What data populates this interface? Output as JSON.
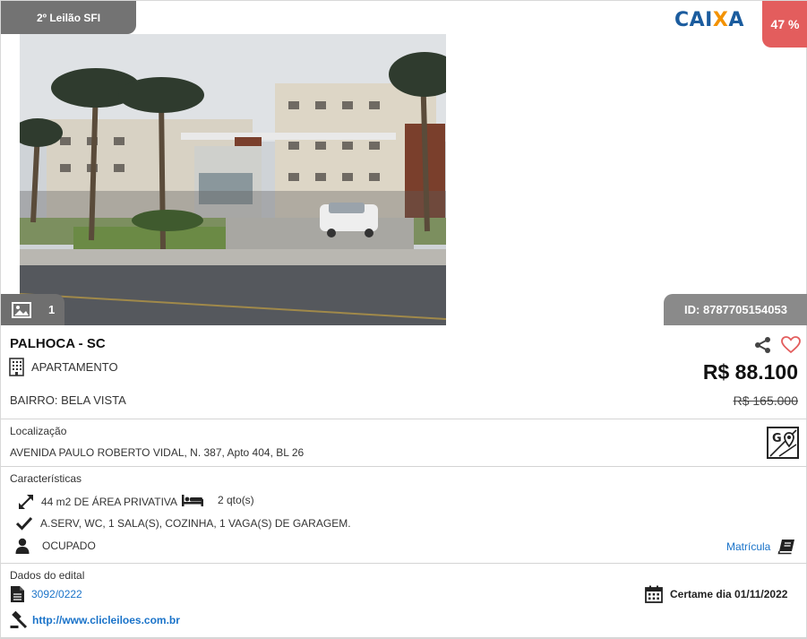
{
  "listing": {
    "auction_tag": "2º Leilão SFI",
    "bank": {
      "logo_text_left": "CAI",
      "logo_text_x": "X",
      "logo_text_right": "A",
      "color": "#1b5c9e",
      "accent": "#f39200"
    },
    "discount": "47 %",
    "photo_count": "1",
    "id_label": "ID: 8787705154053",
    "city": "PALHOCA - SC",
    "property_type": "APARTAMENTO",
    "neighborhood": "BAIRRO: BELA VISTA",
    "price": "R$ 88.100",
    "old_price": "R$ 165.000"
  },
  "location": {
    "title": "Localização",
    "address": "AVENIDA PAULO ROBERTO VIDAL, N. 387, Apto 404, BL 26"
  },
  "features": {
    "title": "Características",
    "area": "44 m2 DE ÁREA PRIVATIVA",
    "bedrooms": "2 qto(s)",
    "rooms": "A.SERV, WC, 1 SALA(S), COZINHA, 1 VAGA(S) DE GARAGEM.",
    "occupancy": "OCUPADO",
    "registry_link": "Matrícula"
  },
  "edital": {
    "title": "Dados do edital",
    "number": "3092/0222",
    "date": "Certame dia 01/11/2022",
    "website": "http://www.clicleiloes.com.br"
  },
  "colors": {
    "discount_bg": "#e35d5d",
    "link": "#1a73c9",
    "tag_bg": "#737373"
  }
}
